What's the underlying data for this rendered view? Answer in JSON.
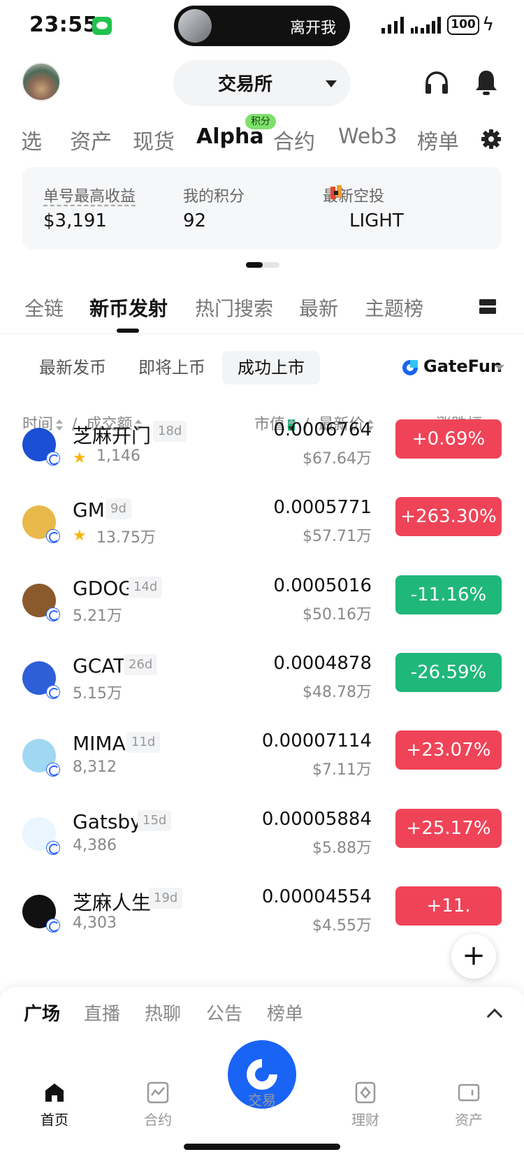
{
  "status_bar": {
    "time": "23:55",
    "island_text": "离开我",
    "battery": "100"
  },
  "header": {
    "exchange_label": "交易所"
  },
  "top_nav": {
    "items": [
      "自选",
      "资产",
      "现货",
      "Alpha",
      "合约",
      "Web3",
      "榜单"
    ],
    "active": "Alpha",
    "points_badge": "积分"
  },
  "stats": {
    "items": [
      {
        "label": "单号最高收益",
        "value": "$3,191"
      },
      {
        "label": "我的积分",
        "value": "92"
      },
      {
        "label": "最新空投",
        "value": "LIGHT"
      }
    ]
  },
  "category_tabs": {
    "items": [
      "全链",
      "新币发射",
      "热门搜索",
      "最新",
      "主题榜"
    ],
    "active": "新币发射"
  },
  "sub_tabs": {
    "items": [
      "最新发币",
      "即将上币",
      "成功上市"
    ],
    "active": "成功上市",
    "filter_label": "GateFun"
  },
  "columns": {
    "time": "时间",
    "volume": "成交额",
    "mcap": "市值",
    "price": "最新价",
    "change": "涨跌幅",
    "sep": "/"
  },
  "tokens": [
    {
      "name": "芝麻开门",
      "age": "18d",
      "starred": true,
      "volume": "1,146",
      "price": "0.0006764",
      "mcap": "$67.64万",
      "change": "+0.69%",
      "dir": "up",
      "logo_color": "#1a4fd6"
    },
    {
      "name": "GM",
      "age": "9d",
      "starred": true,
      "volume": "13.75万",
      "price": "0.0005771",
      "mcap": "$57.71万",
      "change": "+263.30%",
      "dir": "up",
      "logo_color": "#e8b94a"
    },
    {
      "name": "GDOG",
      "age": "14d",
      "starred": false,
      "volume": "5.21万",
      "price": "0.0005016",
      "mcap": "$50.16万",
      "change": "-11.16%",
      "dir": "down",
      "logo_color": "#8a5a2c"
    },
    {
      "name": "GCAT",
      "age": "26d",
      "starred": false,
      "volume": "5.15万",
      "price": "0.0004878",
      "mcap": "$48.78万",
      "change": "-26.59%",
      "dir": "down",
      "logo_color": "#2e5fd8"
    },
    {
      "name": "MIMA",
      "age": "11d",
      "starred": false,
      "volume": "8,312",
      "price": "0.00007114",
      "mcap": "$7.11万",
      "change": "+23.07%",
      "dir": "up",
      "logo_color": "#9fd8f0"
    },
    {
      "name": "Gatsby",
      "age": "15d",
      "starred": false,
      "volume": "4,386",
      "price": "0.00005884",
      "mcap": "$5.88万",
      "change": "+25.17%",
      "dir": "up",
      "logo_color": "#e9f5ff"
    },
    {
      "name": "芝麻人生",
      "age": "19d",
      "starred": false,
      "volume": "4,303",
      "price": "0.00004554",
      "mcap": "$4.55万",
      "change": "+11.",
      "dir": "up",
      "logo_color": "#111111"
    }
  ],
  "sheet_tabs": {
    "items": [
      "广场",
      "直播",
      "热聊",
      "公告",
      "榜单"
    ],
    "active": "广场"
  },
  "bottom_nav": {
    "items": [
      {
        "label": "首页",
        "icon": "home-icon"
      },
      {
        "label": "合约",
        "icon": "chart-icon"
      },
      {
        "label": "交易",
        "icon": "trade-icon"
      },
      {
        "label": "理财",
        "icon": "finance-icon"
      },
      {
        "label": "资产",
        "icon": "wallet-icon"
      }
    ],
    "active": "首页"
  },
  "colors": {
    "up": "#ef4458",
    "down": "#20b77a",
    "brand": "#1964f5"
  }
}
